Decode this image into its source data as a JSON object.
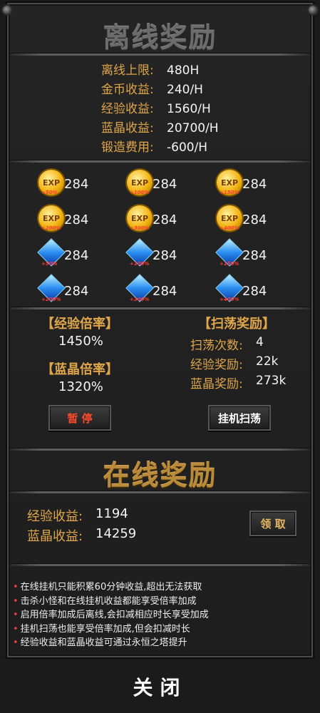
{
  "offline": {
    "title": "离线奖励",
    "stats": [
      {
        "label": "离线上限:",
        "value": "480H"
      },
      {
        "label": "金币收益:",
        "value": "240/H"
      },
      {
        "label": "经验收益:",
        "value": "1560/H"
      },
      {
        "label": "蓝晶收益:",
        "value": "20700/H"
      },
      {
        "label": "锻造费用:",
        "value": "-600/H"
      }
    ],
    "rewards": [
      {
        "icon": "exp-coin-icon",
        "bonus": "+50%",
        "count": "284"
      },
      {
        "icon": "exp-coin-icon",
        "bonus": "+100%",
        "count": "284"
      },
      {
        "icon": "exp-coin-icon",
        "bonus": "+150%",
        "count": "284"
      },
      {
        "icon": "exp-coin-icon",
        "bonus": "+200%",
        "count": "284"
      },
      {
        "icon": "exp-coin-icon",
        "bonus": "+300%",
        "count": "284"
      },
      {
        "icon": "exp-coin-icon",
        "bonus": "+400%",
        "count": "284"
      },
      {
        "icon": "blue-crystal-icon",
        "bonus": "+50%",
        "count": "284"
      },
      {
        "icon": "blue-crystal-icon",
        "bonus": "+100%",
        "count": "284"
      },
      {
        "icon": "blue-crystal-icon",
        "bonus": "+150%",
        "count": "284"
      },
      {
        "icon": "blue-crystal-icon",
        "bonus": "+200%",
        "count": "284"
      },
      {
        "icon": "blue-crystal-icon",
        "bonus": "+300%",
        "count": "284"
      },
      {
        "icon": "blue-crystal-icon",
        "bonus": "+400%",
        "count": "284"
      }
    ],
    "exp_rate_title": "【经验倍率】",
    "exp_rate_value": "1450%",
    "crystal_rate_title": "【蓝晶倍率】",
    "crystal_rate_value": "1320%",
    "sweep_title": "【扫荡奖励】",
    "sweep_rows": [
      {
        "label": "扫荡次数:",
        "value": "4"
      },
      {
        "label": "经验奖励:",
        "value": "22k"
      },
      {
        "label": "蓝晶奖励:",
        "value": "273k"
      }
    ],
    "pause_label": "暂 停",
    "sweep_button_label": "挂机扫荡"
  },
  "online": {
    "title": "在线奖励",
    "rows": [
      {
        "label": "经验收益:",
        "value": "1194"
      },
      {
        "label": "蓝晶收益:",
        "value": "14259"
      }
    ],
    "claim_label": "领 取"
  },
  "notes": [
    "在线挂机只能积累60分钟收益,超出无法获取",
    "击杀小怪和在线挂机收益都能享受倍率加成",
    "启用倍率加成后离线,会扣减相应时长享受加成",
    "挂机扫荡也能享受倍率加成,但会扣减时长",
    "经验收益和蓝晶收益可通过永恒之塔提升"
  ],
  "close_label": "关闭",
  "colors": {
    "accent": "#e0a64a",
    "bonus": "#ff3b3b",
    "pause": "#ff4a2a"
  }
}
